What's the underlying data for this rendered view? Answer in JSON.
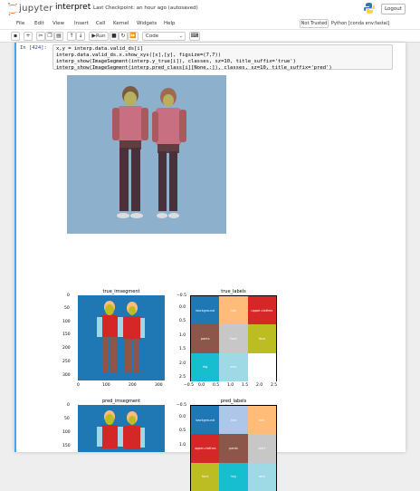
{
  "header": {
    "logo_text": "jupyter",
    "notebook_title": "interpret",
    "checkpoint": "Last Checkpoint: an hour ago  (autosaved)",
    "logout_label": "Logout"
  },
  "menubar": {
    "items": [
      "File",
      "Edit",
      "View",
      "Insert",
      "Cell",
      "Kernel",
      "Widgets",
      "Help"
    ],
    "trust_label": "Not Trusted",
    "kernel_label": "Python [conda env:fastai]"
  },
  "toolbar": {
    "run_label": "Run",
    "cell_type": "Code"
  },
  "cell": {
    "prompt": "In [424]:",
    "code": [
      "x,y = interp.data.valid_ds[i]",
      "interp.data.valid_ds.x.show_xys([x],[y], figsize=(7,7))",
      "interp_show(ImageSegment(interp.y_true[i]), classes, sz=10, title_suffix='true')",
      "interp_show(ImageSegment(interp.pred_class[i][None,:]), classes, sz=10, title_suffix='pred')"
    ]
  },
  "plots": {
    "true_imsegment_title": "true_imsegment",
    "true_labels_title": "true_labels",
    "pred_imsegment_title": "pred_imsegment",
    "pred_labels_title": "pred_labels",
    "img_yticks": [
      "0",
      "50",
      "100",
      "150",
      "200",
      "250",
      "300"
    ],
    "img_xticks": [
      "0",
      "100",
      "200",
      "300"
    ],
    "grid_yticks": [
      "−0.5",
      "0.0",
      "0.5",
      "1.0",
      "1.5",
      "2.0",
      "2.5"
    ],
    "grid_xticks": [
      "−0.5",
      "0.0",
      "0.5",
      "1.0",
      "1.5",
      "2.0",
      "2.5"
    ],
    "true_labels": [
      {
        "label": "background",
        "color": "#1f77b4"
      },
      {
        "label": "hair",
        "color": "#ffbb78"
      },
      {
        "label": "upper-clothes",
        "color": "#d62728"
      },
      {
        "label": "pants",
        "color": "#8c564b"
      },
      {
        "label": "face",
        "color": "#c7c7c7"
      },
      {
        "label": "face",
        "color": "#bcbd22"
      },
      {
        "label": "leg",
        "color": "#17becf"
      },
      {
        "label": "arm",
        "color": "#9edae5"
      },
      {
        "label": "",
        "color": "#ffffff"
      }
    ],
    "pred_labels": [
      {
        "label": "background",
        "color": "#1f77b4"
      },
      {
        "label": "hat",
        "color": "#aec7e8"
      },
      {
        "label": "hair",
        "color": "#ffbb78"
      },
      {
        "label": "upper-clothes",
        "color": "#d62728"
      },
      {
        "label": "pants",
        "color": "#8c564b"
      },
      {
        "label": "skirt",
        "color": "#c7c7c7"
      },
      {
        "label": "face",
        "color": "#bcbd22"
      },
      {
        "label": "leg",
        "color": "#17becf"
      },
      {
        "label": "arm",
        "color": "#9edae5"
      }
    ]
  }
}
